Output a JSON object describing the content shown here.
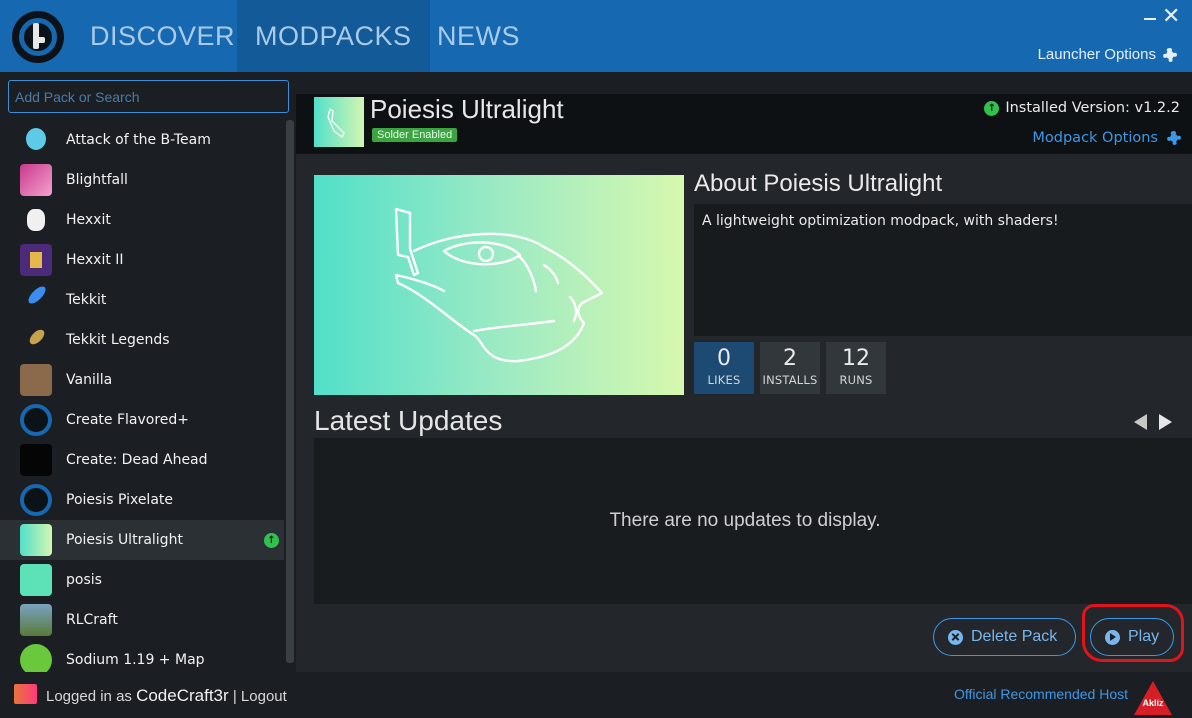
{
  "nav": {
    "tabs": [
      {
        "label": "DISCOVER"
      },
      {
        "label": "MODPACKS"
      },
      {
        "label": "NEWS"
      }
    ],
    "launcher_options": "Launcher Options",
    "window_close": "✕"
  },
  "sidebar": {
    "search_placeholder": "Add Pack or Search",
    "packs": [
      {
        "name": "Attack of the B-Team",
        "icon": "b-team-icon"
      },
      {
        "name": "Blightfall",
        "icon": "blightfall-icon"
      },
      {
        "name": "Hexxit",
        "icon": "hexxit-icon"
      },
      {
        "name": "Hexxit II",
        "icon": "hexxit-ii-icon"
      },
      {
        "name": "Tekkit",
        "icon": "tekkit-icon"
      },
      {
        "name": "Tekkit Legends",
        "icon": "tekkit-legends-icon"
      },
      {
        "name": "Vanilla",
        "icon": "vanilla-icon"
      },
      {
        "name": "Create Flavored+",
        "icon": "technic-icon"
      },
      {
        "name": "Create: Dead Ahead",
        "icon": "dead-ahead-icon"
      },
      {
        "name": "Poiesis Pixelate",
        "icon": "technic-icon"
      },
      {
        "name": "Poiesis Ultralight",
        "icon": "poiesis-ultralight-icon",
        "selected": true,
        "update": true
      },
      {
        "name": "posis",
        "icon": "posis-icon"
      },
      {
        "name": "RLCraft",
        "icon": "rlcraft-icon"
      },
      {
        "name": "Sodium 1.19 + Map",
        "icon": "sodium-icon"
      }
    ]
  },
  "pack": {
    "title": "Poiesis Ultralight",
    "solder_badge": "Solder Enabled",
    "installed_version": "Installed Version: v1.2.2",
    "modpack_options": "Modpack Options",
    "about_title": "About Poiesis Ultralight",
    "description": "A lightweight optimization modpack, with shaders!",
    "stats": {
      "likes": {
        "value": "0",
        "label": "LIKES"
      },
      "installs": {
        "value": "2",
        "label": "INSTALLS"
      },
      "runs": {
        "value": "12",
        "label": "RUNS"
      }
    },
    "updates_title": "Latest Updates",
    "no_updates": "There are no updates to display.",
    "delete_label": "Delete Pack",
    "play_label": "Play"
  },
  "footer": {
    "logged_in_prefix": "Logged in as ",
    "username": "CodeCraft3r",
    "separator": " | ",
    "logout": "Logout",
    "host_label": "Official Recommended Host",
    "host_logo_text": "Aklíz"
  },
  "colors": {
    "accent": "#1669b0",
    "link": "#3e97e6",
    "update_green": "#2fc24d",
    "annotation_red": "#e0141c"
  }
}
